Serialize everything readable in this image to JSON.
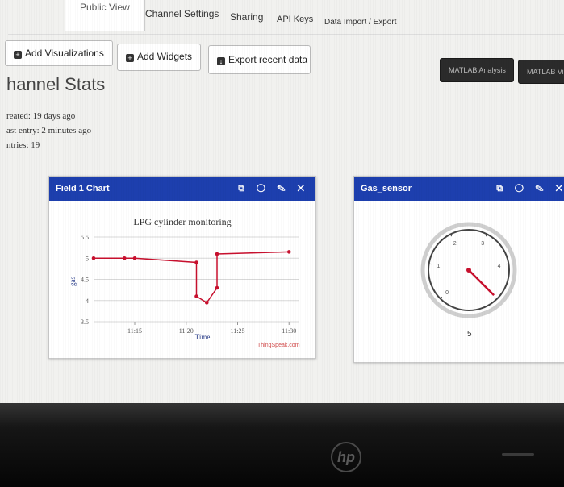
{
  "tabs": {
    "public_view": "Public View",
    "channel_settings": "Channel Settings",
    "sharing": "Sharing",
    "api_keys": "API Keys",
    "data_import_export": "Data Import / Export"
  },
  "toolbar": {
    "add_visualizations": "Add Visualizations",
    "add_widgets": "Add Widgets",
    "export_recent_data": "Export recent data",
    "matlab_analysis": "MATLAB Analysis",
    "matlab_visualization": "MATLAB Vis"
  },
  "stats": {
    "title": "hannel Stats",
    "created": "reated:  19 days ago",
    "last_entry": "ast entry:  2 minutes ago",
    "entries": "ntries: 19"
  },
  "field_chart": {
    "header": "Field 1 Chart",
    "actions": "⧉ ◯ ✎ ✕",
    "footer": "ThingSpeak.com"
  },
  "gas_panel": {
    "header": "Gas_sensor",
    "actions": "⧉ ◯ ✎ ✕",
    "value": "5",
    "gauge_ticks": [
      "0",
      "1",
      "2",
      "3",
      "4"
    ],
    "needle_value": 5,
    "gauge_max": 5
  },
  "colors": {
    "header_blue": "#1d3fae",
    "series_red": "#c8102e"
  },
  "chart_data": {
    "type": "line",
    "title": "LPG cylinder monitoring",
    "xlabel": "Time",
    "ylabel": "gas",
    "ylim": [
      3.5,
      5.5
    ],
    "yticks": [
      "3.5",
      "4",
      "4.5",
      "5",
      "5.5"
    ],
    "xticks": [
      "11:15",
      "11:20",
      "11:25",
      "11:30"
    ],
    "xlim": [
      "11:11",
      "11:31"
    ],
    "x": [
      "11:11",
      "11:14",
      "11:15",
      "11:21",
      "11:21",
      "11:22",
      "11:23",
      "11:23",
      "11:30"
    ],
    "series": [
      {
        "values": [
          5.0,
          5.0,
          5.0,
          4.9,
          4.1,
          3.95,
          4.3,
          5.1,
          5.15
        ]
      }
    ],
    "grid": true
  }
}
